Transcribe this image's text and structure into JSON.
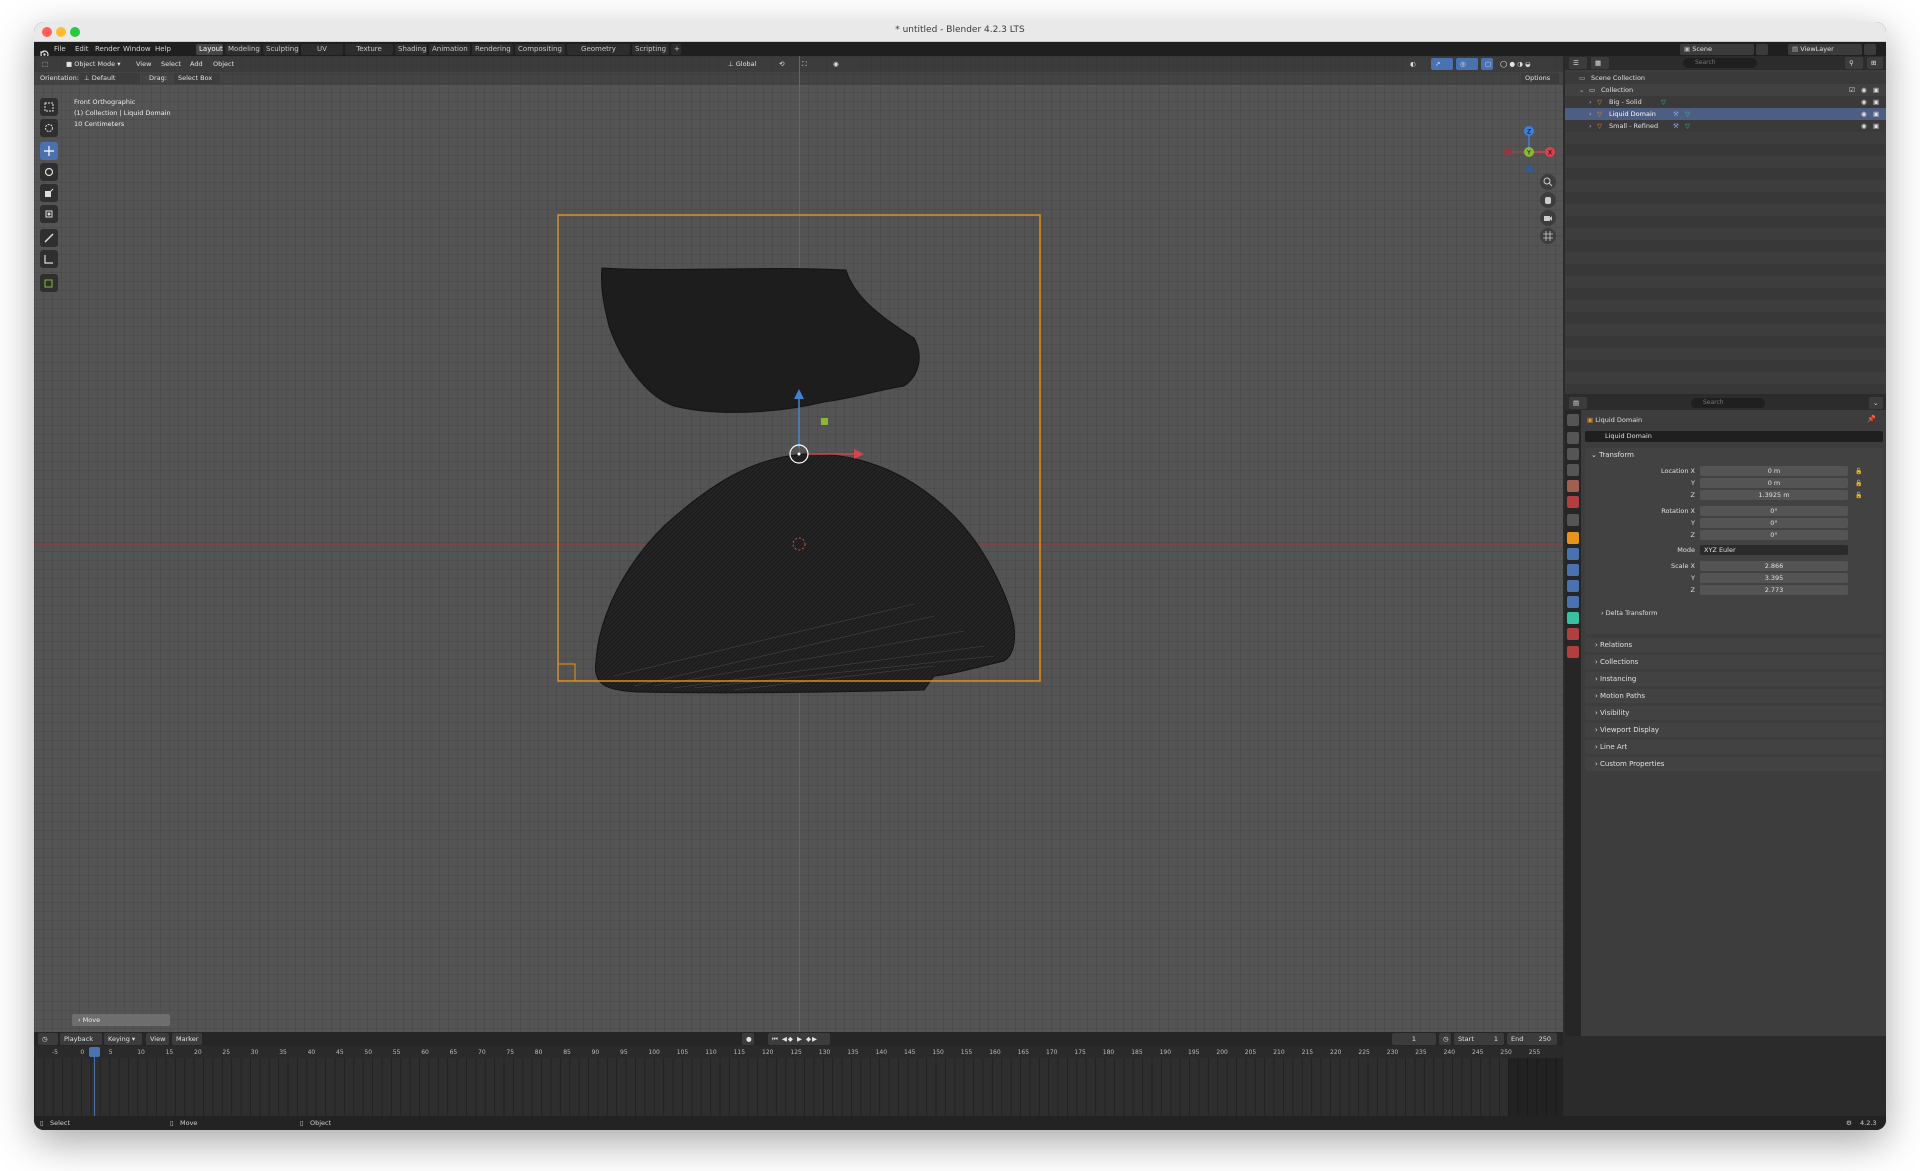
{
  "window_title": "* untitled - Blender 4.2.3 LTS",
  "menu": [
    "File",
    "Edit",
    "Render",
    "Window",
    "Help"
  ],
  "workspaces": [
    "Layout",
    "Modeling",
    "Sculpting",
    "UV Editing",
    "Texture Paint",
    "Shading",
    "Animation",
    "Rendering",
    "Compositing",
    "Geometry Nodes",
    "Scripting"
  ],
  "active_workspace": "Layout",
  "scene": {
    "label": "Scene",
    "view_layer": "ViewLayer"
  },
  "viewport": {
    "mode": "Object Mode",
    "header_menus": [
      "View",
      "Select",
      "Add",
      "Object"
    ],
    "transform_orientation": "Global",
    "orientation_label": "Orientation:",
    "orientation_value": "Default",
    "drag_label": "Drag:",
    "drag_value": "Select Box",
    "options": "Options",
    "view_name": "Front Orthographic",
    "collection_info": "(1) Collection | Liquid Domain",
    "scale_info": "10 Centimeters",
    "last_operator": "Move",
    "gizmo_axes": {
      "z": "Z",
      "y": "Y",
      "x": "X"
    }
  },
  "outliner": {
    "search_placeholder": "Search",
    "scene_collection": "Scene Collection",
    "collection": "Collection",
    "objects": [
      {
        "name": "Big - Solid"
      },
      {
        "name": "Liquid Domain"
      },
      {
        "name": "Small - Refined"
      }
    ]
  },
  "properties": {
    "search_placeholder": "Search",
    "object_name": "Liquid Domain",
    "object_field": "Liquid Domain",
    "transform_title": "Transform",
    "location_label": "Location X",
    "rotation_label": "Rotation X",
    "scale_label": "Scale X",
    "y_label": "Y",
    "z_label": "Z",
    "mode_label": "Mode",
    "location": {
      "x": "0 m",
      "y": "0 m",
      "z": "1.3925 m"
    },
    "rotation": {
      "x": "0°",
      "y": "0°",
      "z": "0°"
    },
    "mode": "XYZ Euler",
    "scale": {
      "x": "2.866",
      "y": "3.395",
      "z": "2.773"
    },
    "delta_transform": "Delta Transform",
    "panels": [
      "Relations",
      "Collections",
      "Instancing",
      "Motion Paths",
      "Visibility",
      "Viewport Display",
      "Line Art",
      "Custom Properties"
    ]
  },
  "timeline": {
    "menus": [
      "Playback",
      "Keying",
      "View",
      "Marker"
    ],
    "current_frame": "1",
    "start_label": "Start",
    "start": "1",
    "end_label": "End",
    "end": "250",
    "ticks": [
      "-5",
      "0",
      "5",
      "10",
      "15",
      "20",
      "25",
      "30",
      "35",
      "40",
      "45",
      "50",
      "55",
      "60",
      "65",
      "70",
      "75",
      "80",
      "85",
      "90",
      "95",
      "100",
      "105",
      "110",
      "115",
      "120",
      "125",
      "130",
      "135",
      "140",
      "145",
      "150",
      "155",
      "160",
      "165",
      "170",
      "175",
      "180",
      "185",
      "190",
      "195",
      "200",
      "205",
      "210",
      "215",
      "220",
      "225",
      "230",
      "235",
      "240",
      "245",
      "250",
      "255"
    ]
  },
  "statusbar": {
    "select": "Select",
    "move": "Move",
    "object": "Object",
    "version": "4.2.3"
  },
  "colors": {
    "accent": "#4a72b0",
    "selection": "#e8941a",
    "x_axis": "#d8414e",
    "y_axis": "#8bb830",
    "z_axis": "#3f7fd6"
  }
}
